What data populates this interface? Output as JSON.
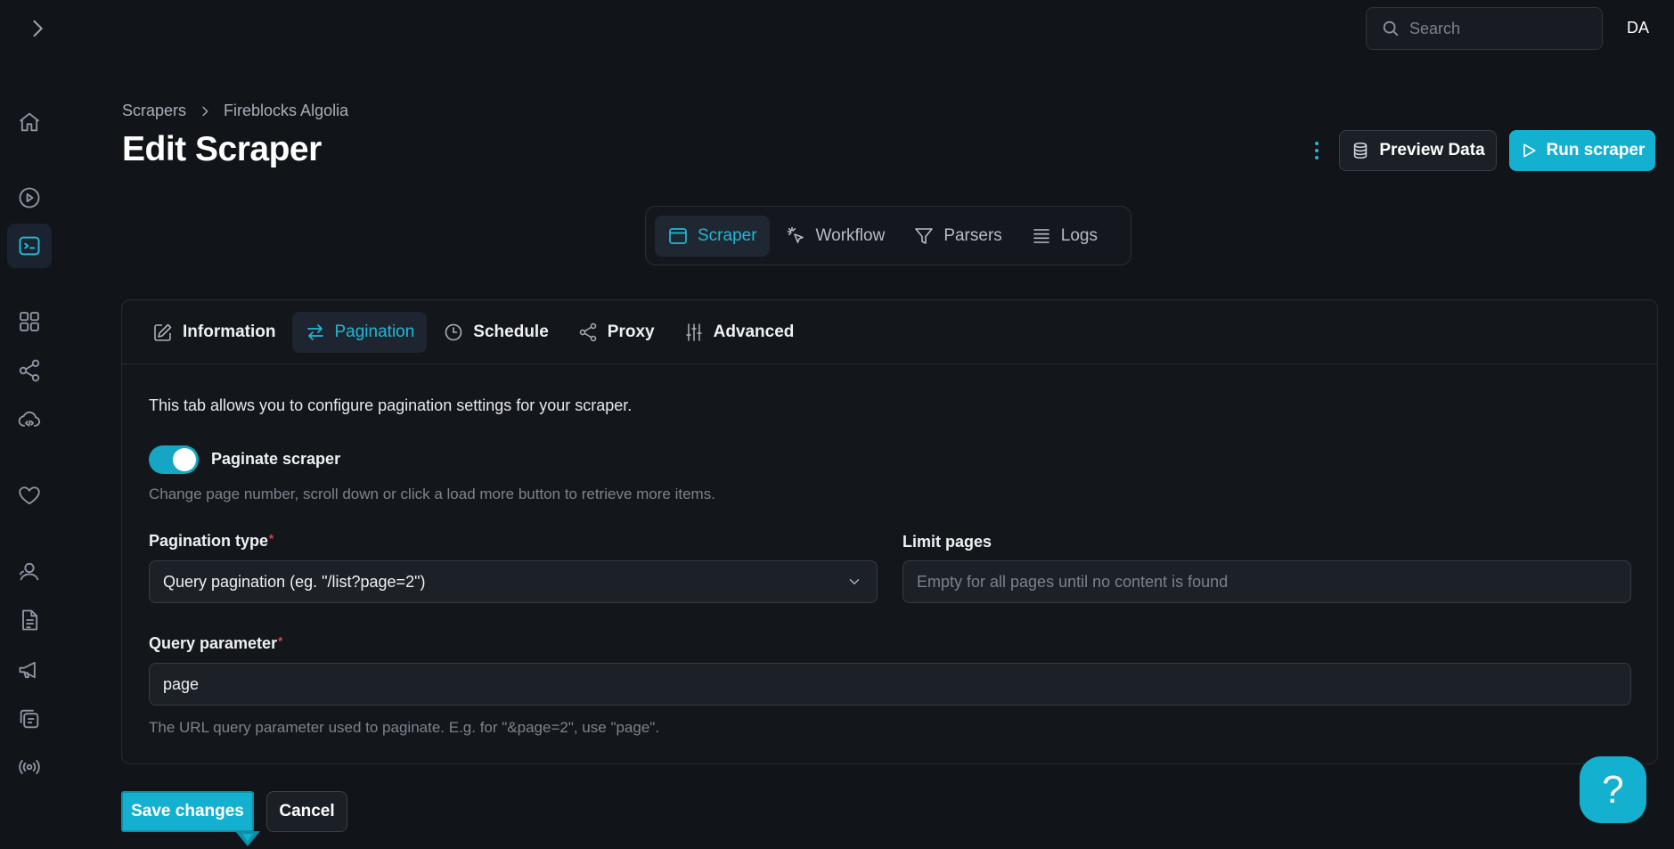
{
  "header": {
    "search_placeholder": "Search",
    "user_initials": "DA"
  },
  "breadcrumb": [
    "Scrapers",
    "Fireblocks Algolia"
  ],
  "page_title": "Edit Scraper",
  "actions": {
    "preview_label": "Preview Data",
    "run_label": "Run scraper"
  },
  "main_tabs": [
    {
      "label": "Scraper",
      "icon": "browser-window-icon",
      "active": true
    },
    {
      "label": "Workflow",
      "icon": "cursor-click-icon",
      "active": false
    },
    {
      "label": "Parsers",
      "icon": "filter-icon",
      "active": false
    },
    {
      "label": "Logs",
      "icon": "list-icon",
      "active": false
    }
  ],
  "sub_tabs": [
    {
      "label": "Information",
      "icon": "pencil-icon",
      "active": false
    },
    {
      "label": "Pagination",
      "icon": "arrows-swap-icon",
      "active": true
    },
    {
      "label": "Schedule",
      "icon": "clock-icon",
      "active": false
    },
    {
      "label": "Proxy",
      "icon": "share-nodes-icon",
      "active": false
    },
    {
      "label": "Advanced",
      "icon": "sliders-icon",
      "active": false
    }
  ],
  "pagination": {
    "description": "This tab allows you to configure pagination settings for your scraper.",
    "toggle_label": "Paginate scraper",
    "toggle_on": true,
    "toggle_help": "Change page number, scroll down or click a load more button to retrieve more items.",
    "type_label": "Pagination type",
    "type_value": "Query pagination (eg. \"/list?page=2\")",
    "limit_label": "Limit pages",
    "limit_placeholder": "Empty for all pages until no content is found",
    "query_label": "Query parameter",
    "query_value": "page",
    "query_help": "The URL query parameter used to paginate. E.g. for \"&page=2\", use \"page\".",
    "required_mark": "*"
  },
  "footer": {
    "save_label": "Save changes",
    "cancel_label": "Cancel",
    "help_label": "?"
  },
  "colors": {
    "accent": "#14b0cf",
    "background": "#111419",
    "card": "#13161b"
  }
}
